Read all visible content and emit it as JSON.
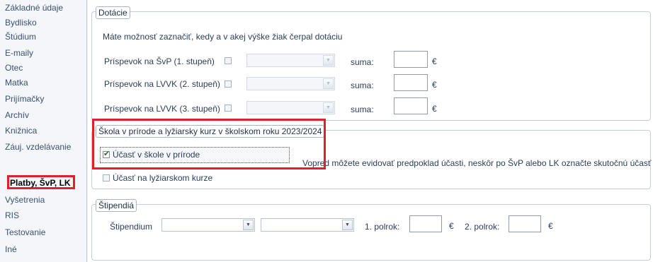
{
  "sidebar": {
    "items": [
      {
        "label": "Základné údaje",
        "active": false
      },
      {
        "label": "Bydlisko",
        "active": false
      },
      {
        "label": "Štúdium",
        "active": false
      },
      {
        "label": "E-maily",
        "active": false
      },
      {
        "label": "Otec",
        "active": false
      },
      {
        "label": "Matka",
        "active": false
      },
      {
        "label": "Prijímačky",
        "active": false
      },
      {
        "label": "Archív",
        "active": false
      },
      {
        "label": "Knižnica",
        "active": false
      },
      {
        "label": "Záuj. vzdelávanie",
        "active": false
      },
      {
        "label": "Platby, ŠvP, LK",
        "active": true
      },
      {
        "label": "Vyšetrenia",
        "active": false
      },
      {
        "label": "RIS",
        "active": false
      },
      {
        "label": "Testovanie",
        "active": false
      },
      {
        "label": "Iné",
        "active": false
      }
    ]
  },
  "dotacie": {
    "title": "Dotácie",
    "description": "Máte možnosť zaznačiť, kedy a v akej výške žiak čerpal dotáciu",
    "rows": [
      {
        "label": "Príspevok na ŠvP (1. stupeň)",
        "checked": false,
        "combo_value": "",
        "sum_label": "suma:",
        "sum_value": "",
        "currency": "€"
      },
      {
        "label": "Príspevok na LVVK (2. stupeň)",
        "checked": false,
        "combo_value": "",
        "sum_label": "suma:",
        "sum_value": "",
        "currency": "€"
      },
      {
        "label": "Príspevok na LVVK (3. stupeň)",
        "checked": false,
        "combo_value": "",
        "sum_label": "suma:",
        "sum_value": "",
        "currency": "€"
      }
    ]
  },
  "skola": {
    "title": "Škola v prírode a lyžiarsky kurz v školskom roku 2023/2024",
    "ucast_svp": {
      "label": "Účasť v škole v prírode",
      "checked": true
    },
    "ucast_lk": {
      "label": "Účasť na lyžiarskom kurze",
      "checked": false
    },
    "note": "Vopred môžete evidovať predpoklad účasti, neskôr po ŠvP alebo LK označte skutočnú účasť"
  },
  "stipendia": {
    "title": "Štipendiá",
    "label": "Štipendium",
    "combo1_value": "",
    "combo2_value": "",
    "polrok1_label": "1. polrok:",
    "polrok1_value": "",
    "polrok2_label": "2. polrok:",
    "polrok2_value": "",
    "currency": "€"
  },
  "icons": {
    "dropdown": "chevron-down-icon",
    "check": "checkmark-icon"
  },
  "colors": {
    "highlight": "#e0202c",
    "accent_border": "#c4cedb",
    "text": "#1e2f4a"
  }
}
